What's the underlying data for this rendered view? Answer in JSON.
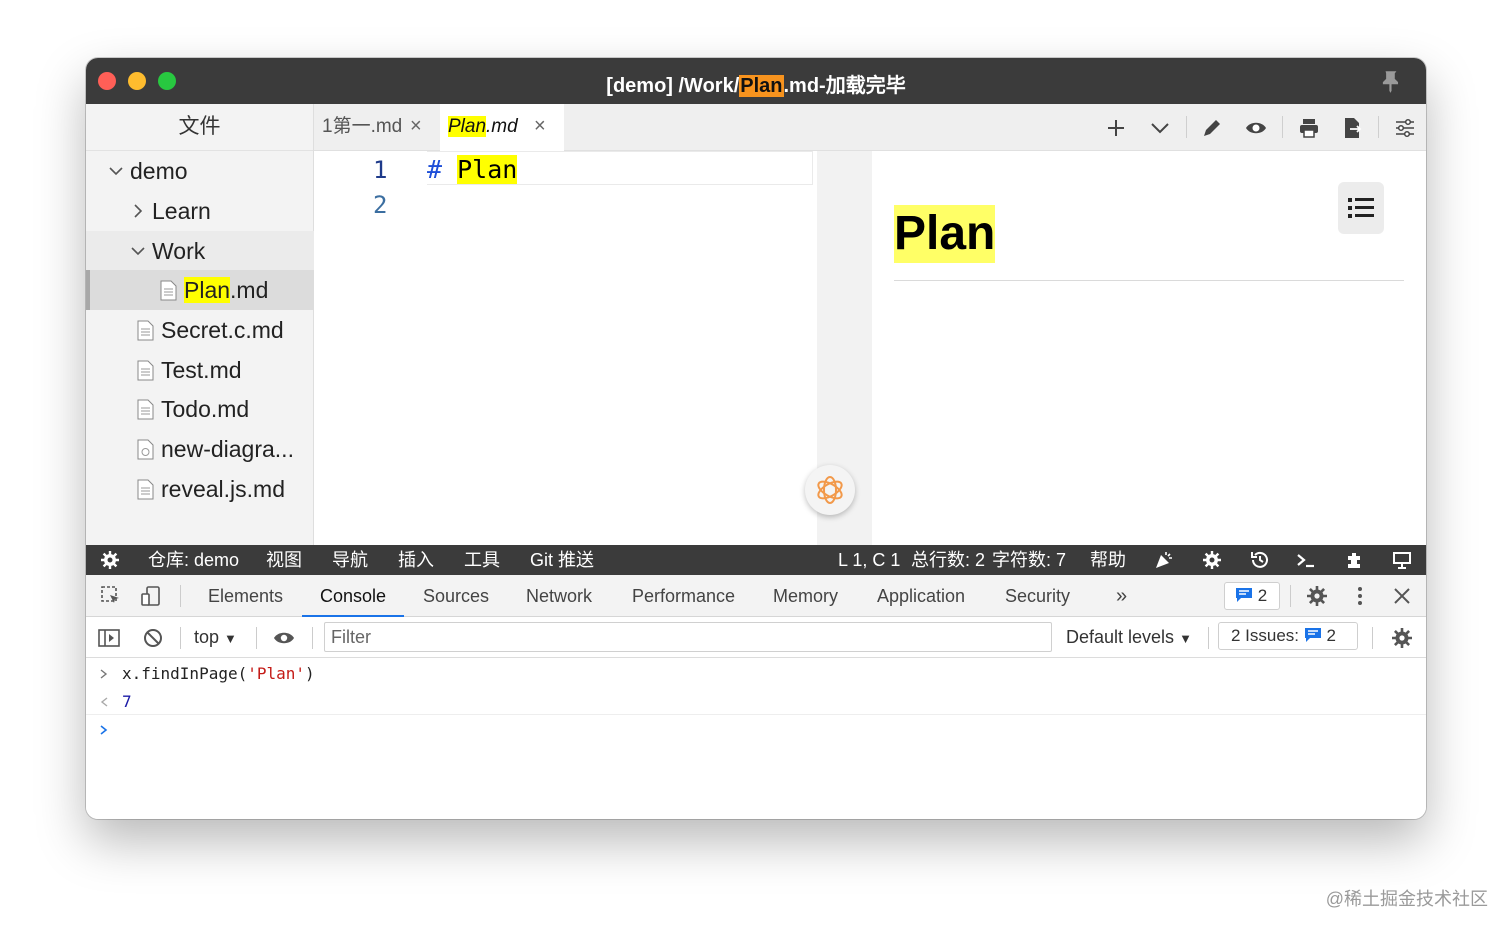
{
  "window": {
    "title_prefix": "[demo] /Work/",
    "title_highlight": "Plan",
    "title_suffix": ".md-加载完毕"
  },
  "sidebar": {
    "header": "文件",
    "tree": [
      {
        "label": "demo",
        "kind": "folder",
        "state": "expanded"
      },
      {
        "label": "Learn",
        "kind": "folder",
        "state": "collapsed"
      },
      {
        "label": "Work",
        "kind": "folder",
        "state": "expanded"
      },
      {
        "label_highlight": "Plan",
        "label_rest": ".md",
        "kind": "file",
        "selected": true
      },
      {
        "label": "Secret.c.md",
        "kind": "file"
      },
      {
        "label": "Test.md",
        "kind": "file"
      },
      {
        "label": "Todo.md",
        "kind": "file"
      },
      {
        "label": "new-diagra...",
        "kind": "diagram-file"
      },
      {
        "label": "reveal.js.md",
        "kind": "file"
      }
    ]
  },
  "tabs": [
    {
      "label": "1第一.md",
      "active": false
    },
    {
      "label_highlight": "Plan",
      "label_rest": ".md",
      "active": true
    }
  ],
  "toolbar_icons": [
    "plus-icon",
    "chevron-down-icon",
    "pencil-icon",
    "eye-icon",
    "print-icon",
    "export-icon",
    "settings-sliders-icon"
  ],
  "editor": {
    "lines": [
      "1",
      "2"
    ],
    "code_hash": "#",
    "code_text": "Plan"
  },
  "preview": {
    "heading": "Plan"
  },
  "statusbar": {
    "repo": "仓库: demo",
    "menu": [
      "视图",
      "导航",
      "插入",
      "工具",
      "Git 推送"
    ],
    "cursor": "L 1, C 1",
    "line_count": "总行数: 2",
    "char_count": "字符数: 7",
    "help": "帮助"
  },
  "devtools": {
    "tabs": [
      "Elements",
      "Console",
      "Sources",
      "Network",
      "Performance",
      "Memory",
      "Application",
      "Security"
    ],
    "active_tab": "Console",
    "more": "»",
    "message_count": "2",
    "context": "top",
    "filter_placeholder": "Filter",
    "levels": "Default levels",
    "issues_label": "2 Issues:",
    "issues_count": "2"
  },
  "console": {
    "input_prefix": "x.findInPage(",
    "input_string": "'Plan'",
    "input_suffix": ")",
    "result": "7"
  },
  "watermark": "@稀土掘金技术社区",
  "colors": {
    "titlebar": "#3b3b3b",
    "highlight_yellow": "#ffff00",
    "title_highlight": "#f7931e",
    "devtools_accent": "#1a73e8"
  }
}
